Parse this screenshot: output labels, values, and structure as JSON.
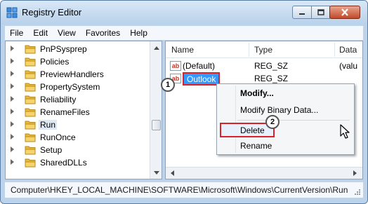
{
  "window": {
    "title": "Registry Editor",
    "controls": {
      "minimize": "minimize-icon",
      "maximize": "maximize-icon",
      "close": "close-icon"
    }
  },
  "menu": [
    "File",
    "Edit",
    "View",
    "Favorites",
    "Help"
  ],
  "tree": {
    "items": [
      {
        "label": "PnPSysprep"
      },
      {
        "label": "Policies"
      },
      {
        "label": "PreviewHandlers"
      },
      {
        "label": "PropertySystem"
      },
      {
        "label": "Reliability"
      },
      {
        "label": "RenameFiles"
      },
      {
        "label": "Run",
        "selected": true
      },
      {
        "label": "RunOnce"
      },
      {
        "label": "Setup"
      },
      {
        "label": "SharedDLLs"
      }
    ]
  },
  "list": {
    "columns": [
      "Name",
      "Type",
      "Data"
    ],
    "rows": [
      {
        "name": "(Default)",
        "type": "REG_SZ",
        "data": "(valu"
      },
      {
        "name": "Outlook",
        "type": "REG_SZ",
        "data": ""
      }
    ]
  },
  "context_menu": {
    "items": [
      "Modify...",
      "Modify Binary Data...",
      "Delete",
      "Rename"
    ]
  },
  "callouts": [
    "1",
    "2"
  ],
  "status_path": "Computer\\HKEY_LOCAL_MACHINE\\SOFTWARE\\Microsoft\\Windows\\CurrentVersion\\Run",
  "colors": {
    "selection": "#3399ff",
    "highlight_border": "#d9232a",
    "chrome": "#bcd3ea"
  }
}
